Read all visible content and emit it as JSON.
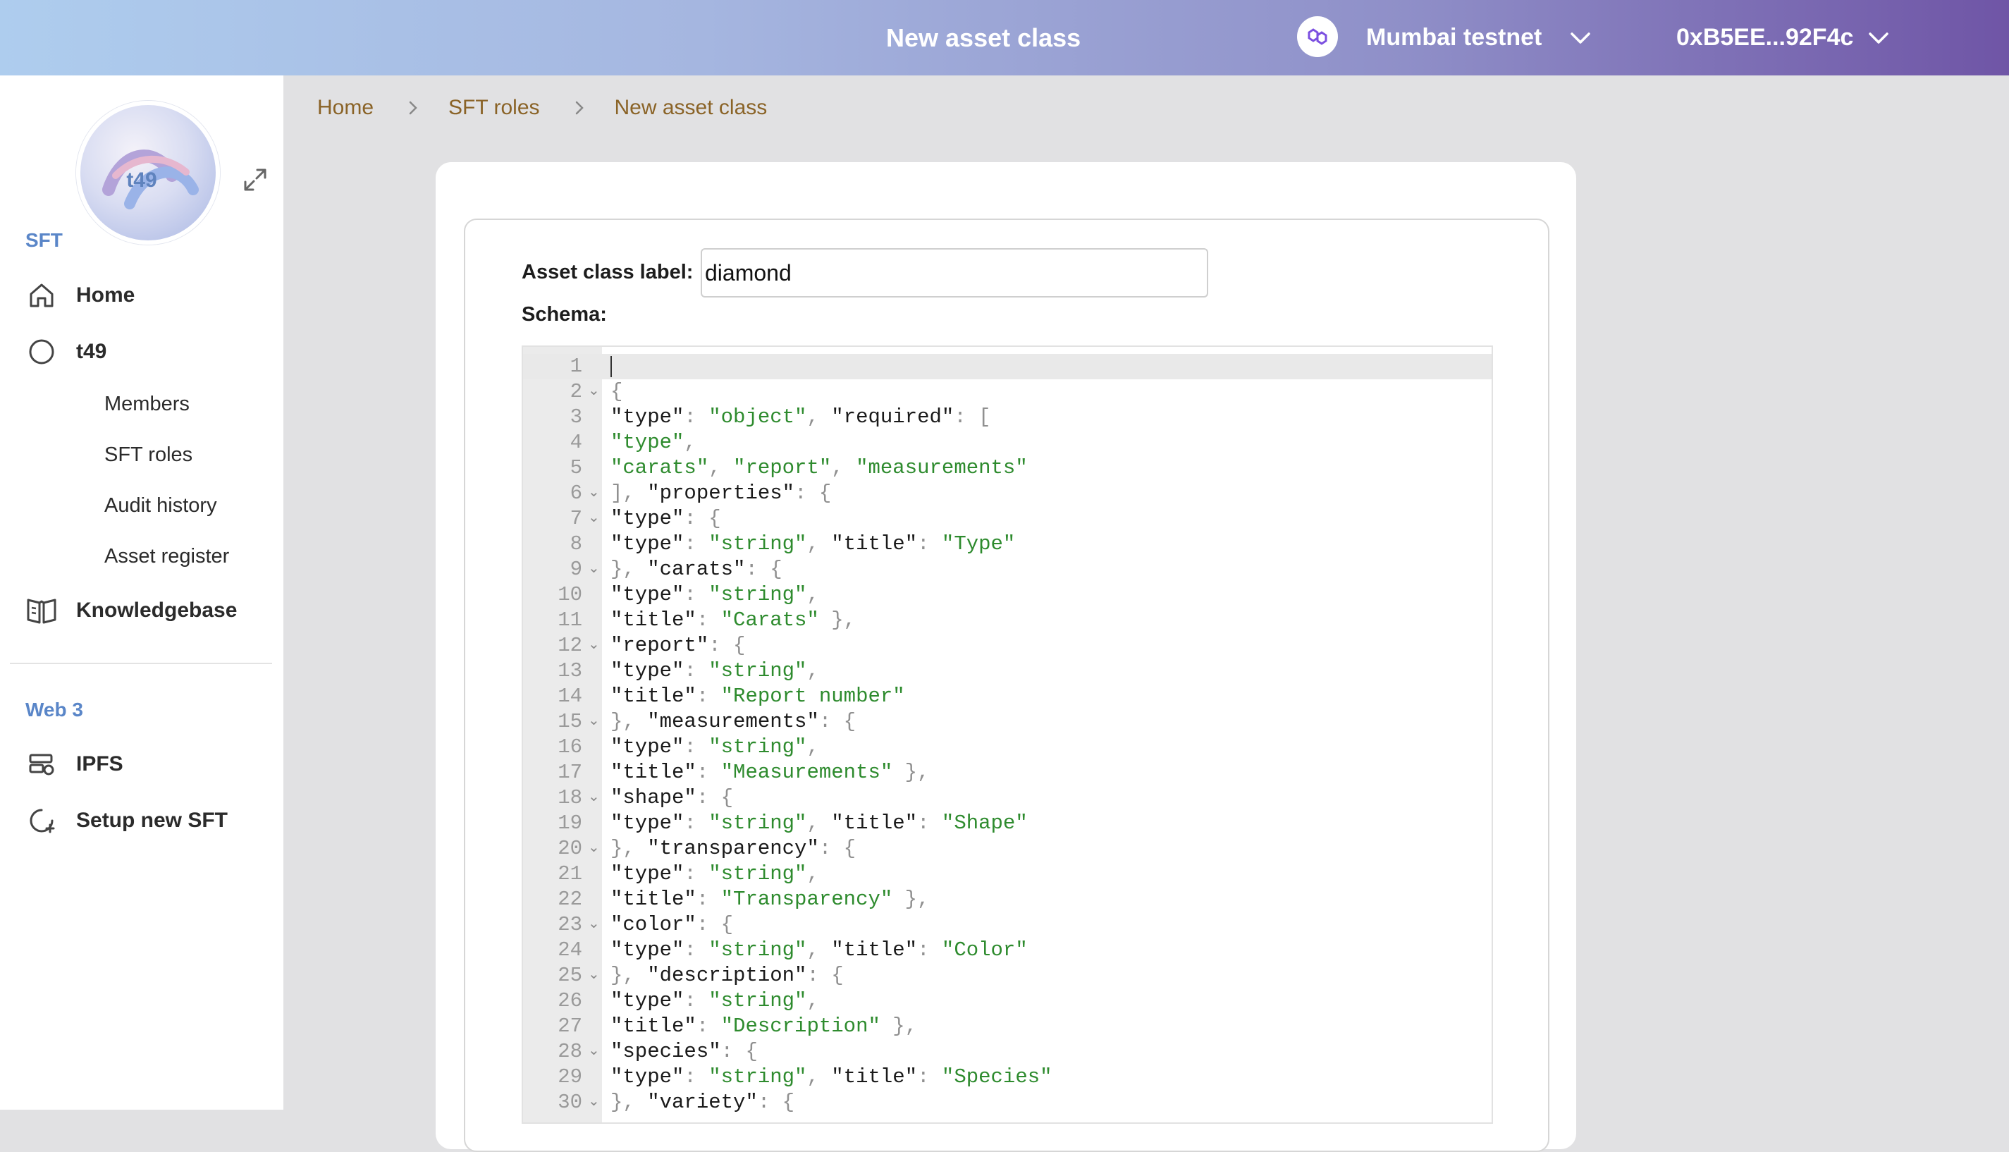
{
  "header": {
    "title": "New asset class",
    "network": "Mumbai testnet",
    "account": "0xB5EE...92F4c"
  },
  "sidebar": {
    "sft_name": "t49",
    "section_sft": "SFT",
    "home": "Home",
    "t49": "t49",
    "members": "Members",
    "sft_roles": "SFT roles",
    "audit_history": "Audit history",
    "asset_register": "Asset register",
    "knowledgebase": "Knowledgebase",
    "section_web3": "Web 3",
    "ipfs": "IPFS",
    "setup_new_sft": "Setup new SFT"
  },
  "breadcrumb": {
    "home": "Home",
    "sft_roles": "SFT roles",
    "current": "New asset class"
  },
  "form": {
    "label_caption": "Asset class label:",
    "label_value": "diamond",
    "schema_caption": "Schema:"
  },
  "editor": {
    "lines": [
      {
        "n": "1",
        "fold": false,
        "t": []
      },
      {
        "n": "2",
        "fold": true,
        "t": [
          [
            "p",
            "{"
          ]
        ]
      },
      {
        "n": "3",
        "fold": false,
        "t": [
          [
            "k",
            "\"type\""
          ],
          [
            "p",
            ": "
          ],
          [
            "s",
            "\"object\""
          ],
          [
            "p",
            ", "
          ],
          [
            "k",
            "\"required\""
          ],
          [
            "p",
            ": ["
          ]
        ]
      },
      {
        "n": "4",
        "fold": false,
        "t": [
          [
            "s",
            "\"type\""
          ],
          [
            "p",
            ","
          ]
        ]
      },
      {
        "n": "5",
        "fold": false,
        "t": [
          [
            "s",
            "\"carats\""
          ],
          [
            "p",
            ", "
          ],
          [
            "s",
            "\"report\""
          ],
          [
            "p",
            ", "
          ],
          [
            "s",
            "\"measurements\""
          ]
        ]
      },
      {
        "n": "6",
        "fold": true,
        "t": [
          [
            "p",
            "], "
          ],
          [
            "k",
            "\"properties\""
          ],
          [
            "p",
            ": {"
          ]
        ]
      },
      {
        "n": "7",
        "fold": true,
        "t": [
          [
            "k",
            "\"type\""
          ],
          [
            "p",
            ": {"
          ]
        ]
      },
      {
        "n": "8",
        "fold": false,
        "t": [
          [
            "k",
            "\"type\""
          ],
          [
            "p",
            ": "
          ],
          [
            "s",
            "\"string\""
          ],
          [
            "p",
            ", "
          ],
          [
            "k",
            "\"title\""
          ],
          [
            "p",
            ": "
          ],
          [
            "s",
            "\"Type\""
          ]
        ]
      },
      {
        "n": "9",
        "fold": true,
        "t": [
          [
            "p",
            "}, "
          ],
          [
            "k",
            "\"carats\""
          ],
          [
            "p",
            ": {"
          ]
        ]
      },
      {
        "n": "10",
        "fold": false,
        "t": [
          [
            "k",
            "\"type\""
          ],
          [
            "p",
            ": "
          ],
          [
            "s",
            "\"string\""
          ],
          [
            "p",
            ","
          ]
        ]
      },
      {
        "n": "11",
        "fold": false,
        "t": [
          [
            "k",
            "\"title\""
          ],
          [
            "p",
            ": "
          ],
          [
            "s",
            "\"Carats\""
          ],
          [
            "p",
            " },"
          ]
        ]
      },
      {
        "n": "12",
        "fold": true,
        "t": [
          [
            "k",
            "\"report\""
          ],
          [
            "p",
            ": {"
          ]
        ]
      },
      {
        "n": "13",
        "fold": false,
        "t": [
          [
            "k",
            "\"type\""
          ],
          [
            "p",
            ": "
          ],
          [
            "s",
            "\"string\""
          ],
          [
            "p",
            ","
          ]
        ]
      },
      {
        "n": "14",
        "fold": false,
        "t": [
          [
            "k",
            "\"title\""
          ],
          [
            "p",
            ": "
          ],
          [
            "s",
            "\"Report number\""
          ]
        ]
      },
      {
        "n": "15",
        "fold": true,
        "t": [
          [
            "p",
            "}, "
          ],
          [
            "k",
            "\"measurements\""
          ],
          [
            "p",
            ": {"
          ]
        ]
      },
      {
        "n": "16",
        "fold": false,
        "t": [
          [
            "k",
            "\"type\""
          ],
          [
            "p",
            ": "
          ],
          [
            "s",
            "\"string\""
          ],
          [
            "p",
            ","
          ]
        ]
      },
      {
        "n": "17",
        "fold": false,
        "t": [
          [
            "k",
            "\"title\""
          ],
          [
            "p",
            ": "
          ],
          [
            "s",
            "\"Measurements\""
          ],
          [
            "p",
            " },"
          ]
        ]
      },
      {
        "n": "18",
        "fold": true,
        "t": [
          [
            "k",
            "\"shape\""
          ],
          [
            "p",
            ": {"
          ]
        ]
      },
      {
        "n": "19",
        "fold": false,
        "t": [
          [
            "k",
            "\"type\""
          ],
          [
            "p",
            ": "
          ],
          [
            "s",
            "\"string\""
          ],
          [
            "p",
            ", "
          ],
          [
            "k",
            "\"title\""
          ],
          [
            "p",
            ": "
          ],
          [
            "s",
            "\"Shape\""
          ]
        ]
      },
      {
        "n": "20",
        "fold": true,
        "t": [
          [
            "p",
            "}, "
          ],
          [
            "k",
            "\"transparency\""
          ],
          [
            "p",
            ": {"
          ]
        ]
      },
      {
        "n": "21",
        "fold": false,
        "t": [
          [
            "k",
            "\"type\""
          ],
          [
            "p",
            ": "
          ],
          [
            "s",
            "\"string\""
          ],
          [
            "p",
            ","
          ]
        ]
      },
      {
        "n": "22",
        "fold": false,
        "t": [
          [
            "k",
            "\"title\""
          ],
          [
            "p",
            ": "
          ],
          [
            "s",
            "\"Transparency\""
          ],
          [
            "p",
            " },"
          ]
        ]
      },
      {
        "n": "23",
        "fold": true,
        "t": [
          [
            "k",
            "\"color\""
          ],
          [
            "p",
            ": {"
          ]
        ]
      },
      {
        "n": "24",
        "fold": false,
        "t": [
          [
            "k",
            "\"type\""
          ],
          [
            "p",
            ": "
          ],
          [
            "s",
            "\"string\""
          ],
          [
            "p",
            ", "
          ],
          [
            "k",
            "\"title\""
          ],
          [
            "p",
            ": "
          ],
          [
            "s",
            "\"Color\""
          ]
        ]
      },
      {
        "n": "25",
        "fold": true,
        "t": [
          [
            "p",
            "}, "
          ],
          [
            "k",
            "\"description\""
          ],
          [
            "p",
            ": {"
          ]
        ]
      },
      {
        "n": "26",
        "fold": false,
        "t": [
          [
            "k",
            "\"type\""
          ],
          [
            "p",
            ": "
          ],
          [
            "s",
            "\"string\""
          ],
          [
            "p",
            ","
          ]
        ]
      },
      {
        "n": "27",
        "fold": false,
        "t": [
          [
            "k",
            "\"title\""
          ],
          [
            "p",
            ": "
          ],
          [
            "s",
            "\"Description\""
          ],
          [
            "p",
            " },"
          ]
        ]
      },
      {
        "n": "28",
        "fold": true,
        "t": [
          [
            "k",
            "\"species\""
          ],
          [
            "p",
            ": {"
          ]
        ]
      },
      {
        "n": "29",
        "fold": false,
        "t": [
          [
            "k",
            "\"type\""
          ],
          [
            "p",
            ": "
          ],
          [
            "s",
            "\"string\""
          ],
          [
            "p",
            ", "
          ],
          [
            "k",
            "\"title\""
          ],
          [
            "p",
            ": "
          ],
          [
            "s",
            "\"Species\""
          ]
        ]
      },
      {
        "n": "30",
        "fold": true,
        "t": [
          [
            "p",
            "}, "
          ],
          [
            "k",
            "\"variety\""
          ],
          [
            "p",
            ": {"
          ]
        ]
      }
    ]
  }
}
